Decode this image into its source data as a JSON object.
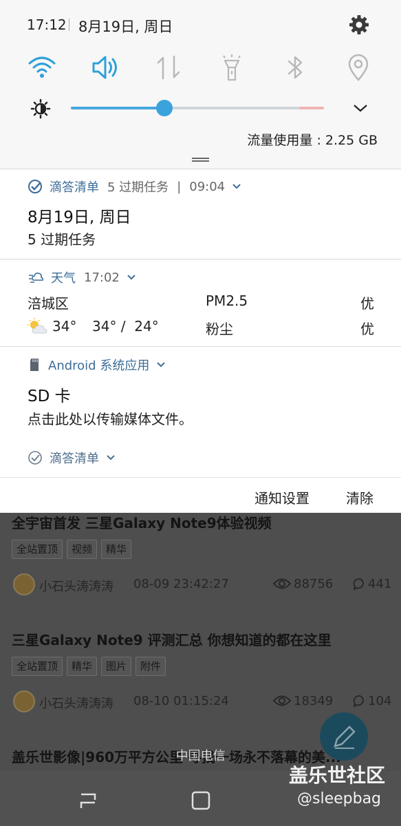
{
  "status_bar": {
    "time": "17:12",
    "date": "8月19日, 周日"
  },
  "quick_settings": {
    "tiles": [
      {
        "icon": "wifi-icon",
        "active": true
      },
      {
        "icon": "sound-icon",
        "active": true
      },
      {
        "icon": "mobile-data-icon",
        "active": false
      },
      {
        "icon": "flashlight-icon",
        "active": false
      },
      {
        "icon": "bluetooth-icon",
        "active": false
      },
      {
        "icon": "location-icon",
        "active": false
      }
    ],
    "brightness_level": 0.37,
    "data_usage": "流量使用量 : 2.25 GB"
  },
  "notifications": [
    {
      "app": "滴答清单",
      "summary": "5 过期任务",
      "sep": "|",
      "time": "09:04",
      "title": "8月19日, 周日",
      "text": "5 过期任务"
    },
    {
      "app": "天气",
      "time": "17:02",
      "location": "涪城区",
      "aqi_label": "PM2.5",
      "aqi_value": "优",
      "temp_now": "34°",
      "temp_range": "34° /  24°",
      "dust_label": "粉尘",
      "dust_value": "优"
    },
    {
      "app": "Android 系统应用",
      "title": "SD 卡",
      "text": "点击此处以传输媒体文件。"
    },
    {
      "app": "滴答清单"
    }
  ],
  "panel_actions": {
    "settings": "通知设置",
    "clear": "清除"
  },
  "background": {
    "posts": [
      {
        "title": "全宇宙首发 三星Galaxy Note9体验视频",
        "tags": [
          "全站置顶",
          "视频",
          "精华"
        ],
        "author": "小石头涛涛涛",
        "time": "08-09 23:42:27",
        "views": "88756",
        "comments": "441"
      },
      {
        "title": "三星Galaxy Note9 评测汇总 你想知道的都在这里",
        "tags": [
          "全站置顶",
          "精华",
          "图片",
          "附件"
        ],
        "author": "小石头涛涛涛",
        "time": "08-10 01:15:24",
        "views": "18349",
        "comments": "104"
      },
      {
        "title": "盖乐世影像|960万平方公里 寻找一场永不落幕的美..."
      }
    ],
    "carrier": "中国电信",
    "watermark_1": "盖乐世社区",
    "watermark_2": "@sleepbag"
  },
  "colors": {
    "accent": "#45a7dd",
    "app_name": "#3c6c97",
    "panel_bg": "#f7f7f7"
  }
}
